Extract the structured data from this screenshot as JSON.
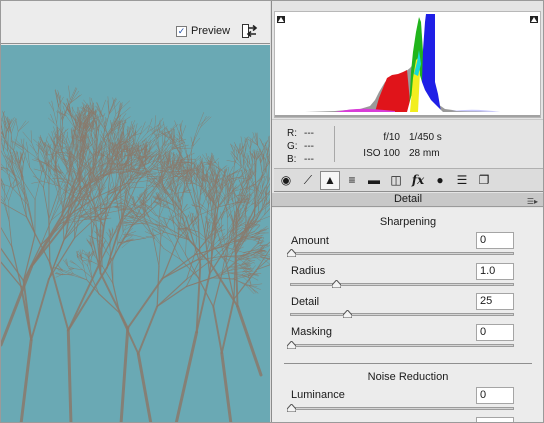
{
  "toolbar": {
    "preview_label": "Preview",
    "preview_checked": true
  },
  "icons": {
    "preview_toggle": "swap-arrows-icon",
    "clip_left": "shadow-clipping-triangle-icon",
    "clip_right": "highlight-clipping-triangle-icon",
    "panel_menu": "panel-menu-icon"
  },
  "readout": {
    "r_label": "R:",
    "r": "---",
    "g_label": "G:",
    "g": "---",
    "b_label": "B:",
    "b": "---"
  },
  "exif": {
    "aperture": "f/10",
    "shutter": "1/450 s",
    "iso": "ISO 100",
    "focal": "28 mm"
  },
  "tabs": [
    {
      "name": "basic",
      "glyph": "◉",
      "active": false
    },
    {
      "name": "tone-curve",
      "glyph": "⟋",
      "active": false
    },
    {
      "name": "detail",
      "glyph": "▲",
      "active": true
    },
    {
      "name": "hsl",
      "glyph": "≡",
      "active": false
    },
    {
      "name": "split-toning",
      "glyph": "▬",
      "active": false
    },
    {
      "name": "lens-corrections",
      "glyph": "◫",
      "active": false
    },
    {
      "name": "effects",
      "glyph": "fx",
      "active": false
    },
    {
      "name": "camera-calibration",
      "glyph": "●",
      "active": false
    },
    {
      "name": "presets",
      "glyph": "☰",
      "active": false
    },
    {
      "name": "snapshots",
      "glyph": "❐",
      "active": false
    }
  ],
  "panel_title": "Detail",
  "sharpening": {
    "title": "Sharpening",
    "sliders": [
      {
        "label": "Amount",
        "value": "0",
        "level": 0
      },
      {
        "label": "Radius",
        "value": "1.0",
        "level": 0.2
      },
      {
        "label": "Detail",
        "value": "25",
        "level": 0.25
      },
      {
        "label": "Masking",
        "value": "0",
        "level": 0
      }
    ]
  },
  "noise": {
    "title": "Noise Reduction",
    "sliders": [
      {
        "label": "Luminance",
        "value": "0",
        "level": 0
      }
    ]
  },
  "colors": {
    "sky": "#6aa9b4",
    "branch": "#8a7a6c"
  }
}
